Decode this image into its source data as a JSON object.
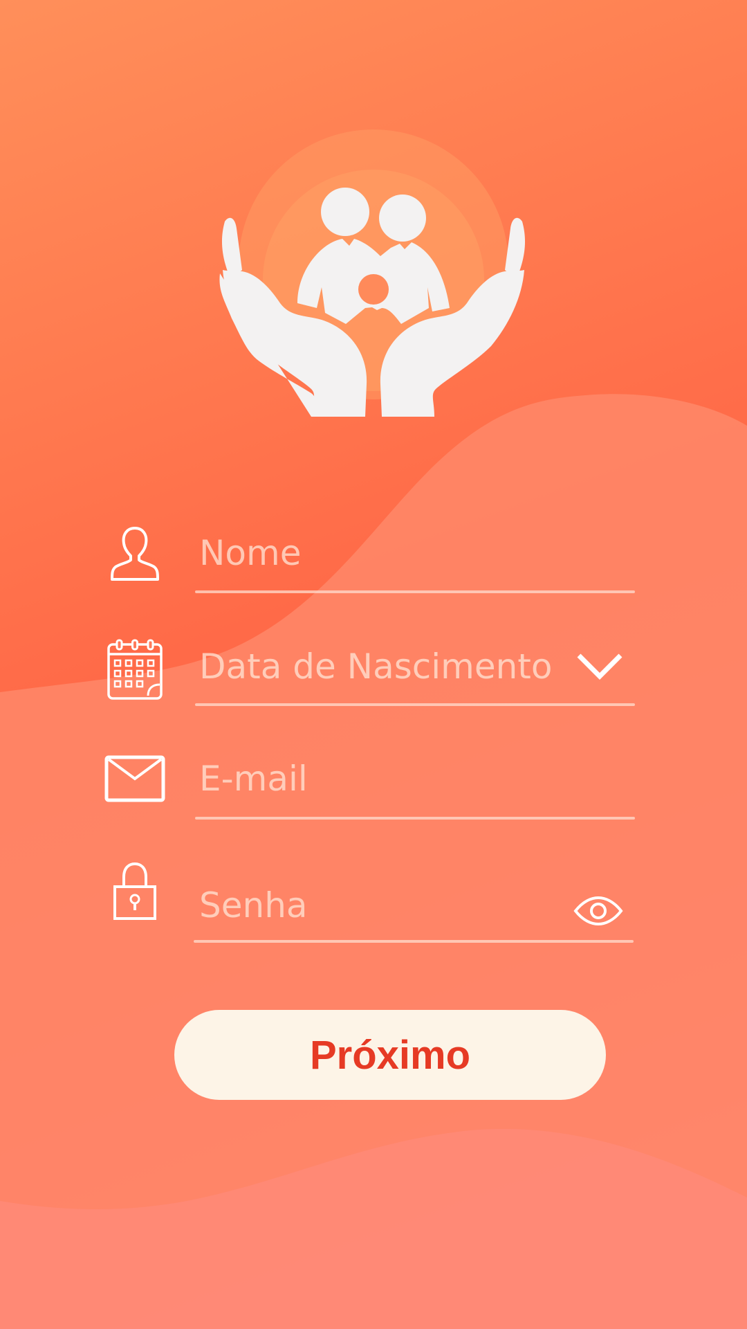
{
  "form": {
    "name_placeholder": "Nome",
    "birthdate_placeholder": "Data de Nascimento",
    "email_placeholder": "E-mail",
    "password_placeholder": "Senha"
  },
  "actions": {
    "next_label": "Próximo"
  },
  "icons": {
    "logo": "family-care-hands-icon",
    "name": "user-icon",
    "birthdate": "calendar-icon",
    "birthdate_trailing": "chevron-down-icon",
    "email": "envelope-icon",
    "password": "lock-icon",
    "password_trailing": "eye-icon"
  },
  "colors": {
    "background_top": "#ff8f5a",
    "background_mid": "#ff6a48",
    "button_bg": "#fdf4e7",
    "button_text": "#e63a24",
    "icon_white": "#ffffff",
    "placeholder": "#ffe2d2"
  }
}
